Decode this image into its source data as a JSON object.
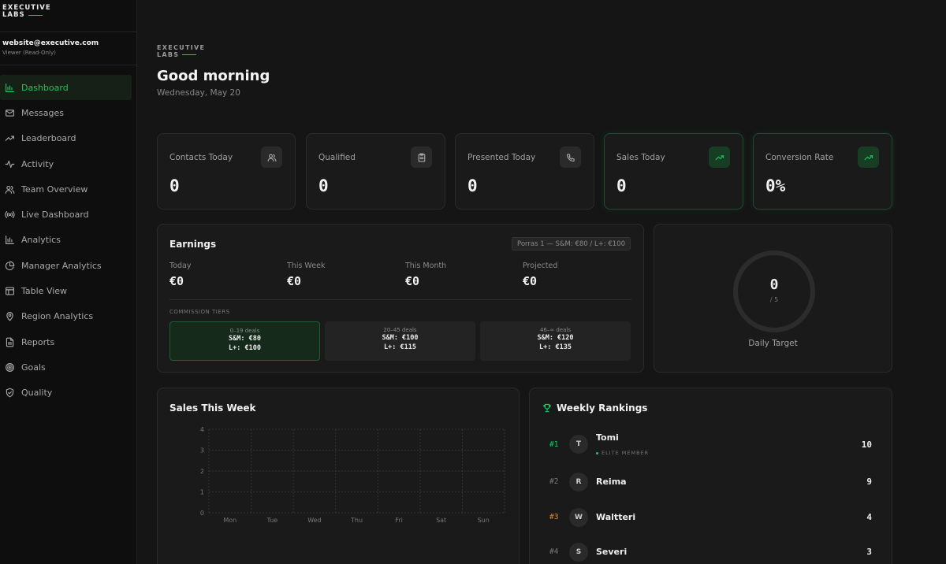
{
  "sidebar": {
    "logo": {
      "line1": "EXECUTIVE",
      "line2": "LABS"
    },
    "user": {
      "email": "website@executive.com",
      "role": "Viewer (Read-Only)"
    },
    "items": [
      {
        "label": "Dashboard",
        "icon": "bar-chart-icon",
        "active": true
      },
      {
        "label": "Messages",
        "icon": "mail-icon"
      },
      {
        "label": "Leaderboard",
        "icon": "trending-up-icon"
      },
      {
        "label": "Activity",
        "icon": "activity-icon"
      },
      {
        "label": "Team Overview",
        "icon": "users-icon"
      },
      {
        "label": "Live Dashboard",
        "icon": "broadcast-icon"
      },
      {
        "label": "Analytics",
        "icon": "bar-chart-icon"
      },
      {
        "label": "Manager Analytics",
        "icon": "pie-chart-icon"
      },
      {
        "label": "Table View",
        "icon": "table-icon"
      },
      {
        "label": "Region Analytics",
        "icon": "map-pin-icon"
      },
      {
        "label": "Reports",
        "icon": "file-icon"
      },
      {
        "label": "Goals",
        "icon": "target-icon"
      },
      {
        "label": "Quality",
        "icon": "shield-check-icon"
      }
    ]
  },
  "header": {
    "brand": {
      "line1": "EXECUTIVE",
      "line2": "LABS"
    },
    "greeting": "Good morning",
    "date": "Wednesday, May 20"
  },
  "stats": [
    {
      "label": "Contacts Today",
      "value": "0",
      "icon": "users-icon"
    },
    {
      "label": "Qualified",
      "value": "0",
      "icon": "clipboard-icon"
    },
    {
      "label": "Presented Today",
      "value": "0",
      "icon": "phone-icon"
    },
    {
      "label": "Sales Today",
      "value": "0",
      "icon": "trending-up-icon"
    },
    {
      "label": "Conversion Rate",
      "value": "0%",
      "icon": "trending-up-icon"
    }
  ],
  "earnings": {
    "title": "Earnings",
    "badge": "Porras 1 — S&M: €80 / L+: €100",
    "today": {
      "label": "Today",
      "value": "€0"
    },
    "week": {
      "label": "This Week",
      "value": "€0"
    },
    "month": {
      "label": "This Month",
      "value": "€0"
    },
    "projected": {
      "label": "Projected",
      "value": "€0"
    },
    "tiers_label": "COMMISSION TIERS",
    "tiers": [
      {
        "range": "0–19 deals",
        "sm": "S&M: €80",
        "lp": "L+: €100"
      },
      {
        "range": "20–45 deals",
        "sm": "S&M: €100",
        "lp": "L+: €115"
      },
      {
        "range": "46–∞ deals",
        "sm": "S&M: €120",
        "lp": "L+: €135"
      }
    ]
  },
  "target": {
    "value": "0",
    "of": "/ 5",
    "label": "Daily Target"
  },
  "sales_week": {
    "title": "Sales This Week"
  },
  "chart_data": {
    "type": "line",
    "title": "Sales This Week",
    "categories": [
      "Mon",
      "Tue",
      "Wed",
      "Thu",
      "Fri",
      "Sat",
      "Sun"
    ],
    "series": [
      {
        "values": [
          0,
          0,
          0,
          0,
          0,
          0,
          0
        ]
      }
    ],
    "y_ticks": [
      "0",
      "1",
      "2",
      "3",
      "4"
    ],
    "ylim": [
      0,
      4
    ],
    "grid": true
  },
  "rankings": {
    "title": "Weekly Rankings",
    "rows": [
      {
        "pos": "#1",
        "initial": "T",
        "name": "Tomi",
        "sub": "ELITE MEMBER",
        "score": "10"
      },
      {
        "pos": "#2",
        "initial": "R",
        "name": "Reima",
        "score": "9"
      },
      {
        "pos": "#3",
        "initial": "W",
        "name": "Waltteri",
        "score": "4"
      },
      {
        "pos": "#4",
        "initial": "S",
        "name": "Severi",
        "score": "3"
      }
    ]
  }
}
